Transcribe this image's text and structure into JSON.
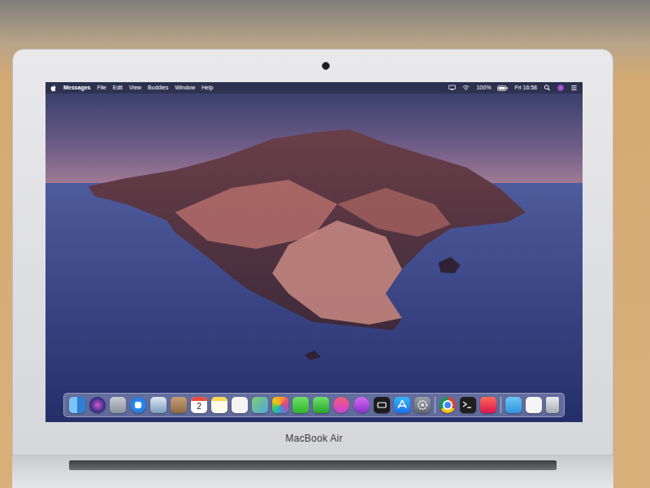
{
  "menu_bar": {
    "app": "Messages",
    "items": [
      "File",
      "Edit",
      "View",
      "Buddies",
      "Window",
      "Help"
    ],
    "battery": "100%",
    "clock": "Fri 16:58"
  },
  "dock": {
    "apps": [
      {
        "kind": "finder"
      },
      {
        "kind": "siri"
      },
      {
        "kind": "launchpad"
      },
      {
        "kind": "safari"
      },
      {
        "kind": "preview"
      },
      {
        "kind": "contacts"
      },
      {
        "kind": "calendar",
        "day": "2"
      },
      {
        "kind": "notes"
      },
      {
        "kind": "reminders"
      },
      {
        "kind": "maps"
      },
      {
        "kind": "photos"
      },
      {
        "kind": "messages"
      },
      {
        "kind": "facetime"
      },
      {
        "kind": "itunes"
      },
      {
        "kind": "podcasts"
      },
      {
        "kind": "tv"
      },
      {
        "kind": "appstore"
      },
      {
        "kind": "preferences"
      },
      {
        "kind": "separator"
      },
      {
        "kind": "chrome"
      },
      {
        "kind": "terminal"
      },
      {
        "kind": "creativecloud"
      },
      {
        "kind": "separator"
      },
      {
        "kind": "downloads"
      },
      {
        "kind": "document"
      },
      {
        "kind": "trash"
      }
    ]
  },
  "bezel_label": "MacBook Air"
}
